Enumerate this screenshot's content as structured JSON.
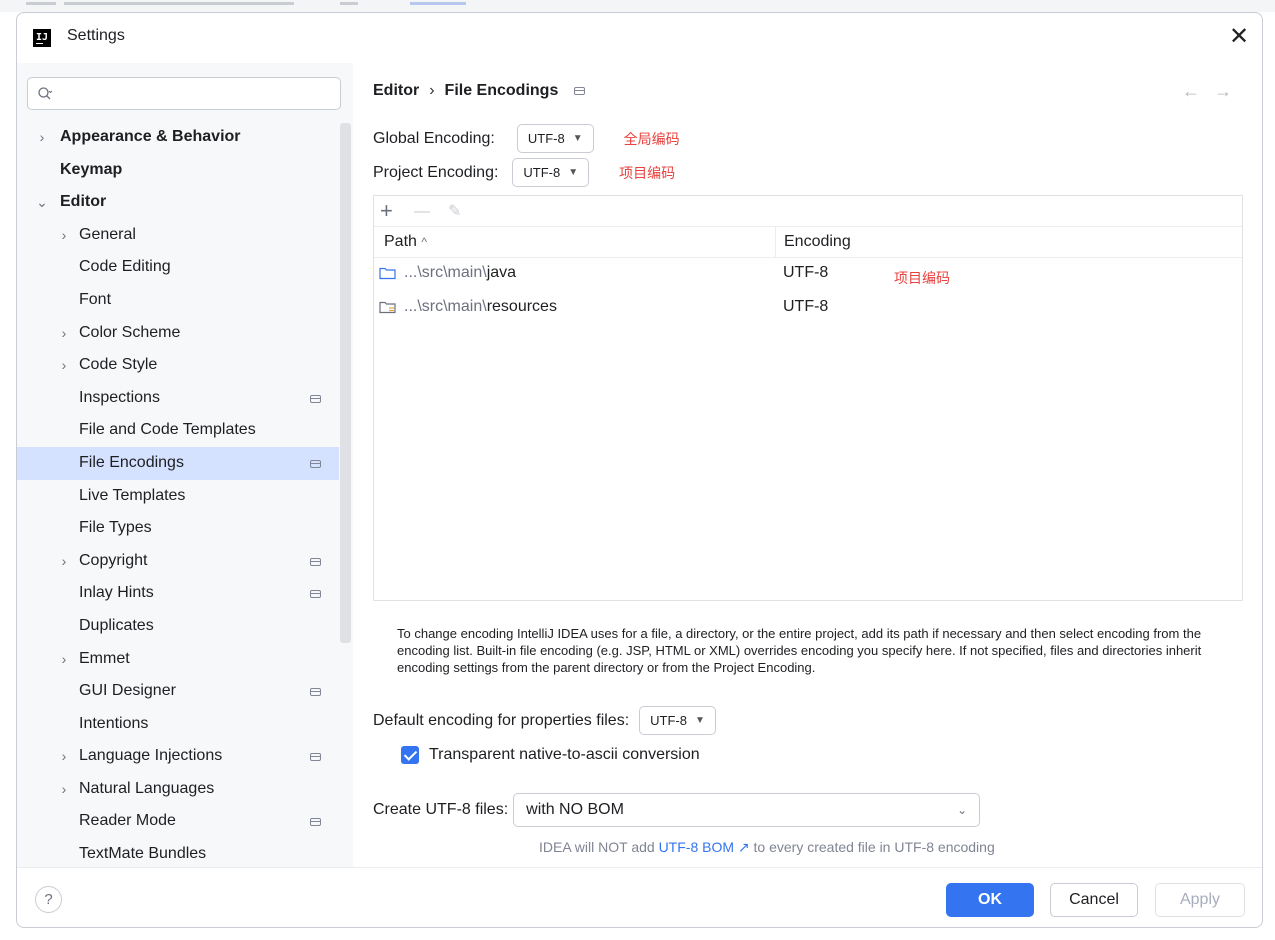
{
  "window": {
    "title": "Settings",
    "app_icon_text": "IJ"
  },
  "search": {
    "placeholder": ""
  },
  "sidebar": {
    "items": [
      {
        "label": "Appearance & Behavior",
        "chevron": "›",
        "bold": true
      },
      {
        "label": "Keymap",
        "bold": true
      },
      {
        "label": "Editor",
        "chevron": "⌄",
        "bold": true
      },
      {
        "label": "General",
        "chevron": "›"
      },
      {
        "label": "Code Editing"
      },
      {
        "label": "Font"
      },
      {
        "label": "Color Scheme",
        "chevron": "›"
      },
      {
        "label": "Code Style",
        "chevron": "›"
      },
      {
        "label": "Inspections",
        "project_icon": true
      },
      {
        "label": "File and Code Templates"
      },
      {
        "label": "File Encodings",
        "project_icon": true,
        "selected": true
      },
      {
        "label": "Live Templates"
      },
      {
        "label": "File Types"
      },
      {
        "label": "Copyright",
        "chevron": "›",
        "project_icon": true
      },
      {
        "label": "Inlay Hints",
        "project_icon": true
      },
      {
        "label": "Duplicates"
      },
      {
        "label": "Emmet",
        "chevron": "›"
      },
      {
        "label": "GUI Designer",
        "project_icon": true
      },
      {
        "label": "Intentions"
      },
      {
        "label": "Language Injections",
        "chevron": "›",
        "project_icon": true
      },
      {
        "label": "Natural Languages",
        "chevron": "›"
      },
      {
        "label": "Reader Mode",
        "project_icon": true
      },
      {
        "label": "TextMate Bundles"
      }
    ]
  },
  "breadcrumb": {
    "parent": "Editor",
    "separator": "›",
    "current": "File Encodings"
  },
  "nav": {
    "back": "←",
    "forward": "→"
  },
  "global_encoding": {
    "label": "Global Encoding:",
    "value": "UTF-8",
    "annotation": "全局编码"
  },
  "project_encoding": {
    "label": "Project Encoding:",
    "value": "UTF-8",
    "annotation": "项目编码"
  },
  "toolbar": {
    "add": "+",
    "remove": "—",
    "edit": "✎"
  },
  "table": {
    "columns": {
      "path": "Path",
      "sort": "^",
      "encoding": "Encoding"
    },
    "rows": [
      {
        "path_prefix": "...\\src\\main\\",
        "path_name": "java",
        "encoding": "UTF-8",
        "annotation": "项目编码"
      },
      {
        "path_prefix": "...\\src\\main\\",
        "path_name": "resources",
        "encoding": "UTF-8",
        "annotation": ""
      }
    ]
  },
  "hint": "To change encoding IntelliJ IDEA uses for a file, a directory, or the entire project, add its path if necessary and then select encoding from the encoding list. Built-in file encoding (e.g. JSP, HTML or XML) overrides encoding you specify here. If not specified, files and directories inherit encoding settings from the parent directory or from the Project Encoding.",
  "properties": {
    "label": "Default encoding for properties files:",
    "value": "UTF-8"
  },
  "native_to_ascii": {
    "label": "Transparent native-to-ascii conversion",
    "checked": true
  },
  "create_utf8": {
    "label": "Create UTF-8 files:",
    "value": "with NO BOM"
  },
  "bom_hint": {
    "prefix": "IDEA will NOT add ",
    "link": "UTF-8 BOM ↗",
    "suffix": " to every created file in UTF-8 encoding"
  },
  "footer": {
    "help": "?",
    "ok": "OK",
    "cancel": "Cancel",
    "apply": "Apply"
  },
  "colors": {
    "accent": "#3574f0",
    "selection": "#d4e2ff",
    "annotation": "#e8413e",
    "sidebar_bg": "#f7f8fa"
  }
}
